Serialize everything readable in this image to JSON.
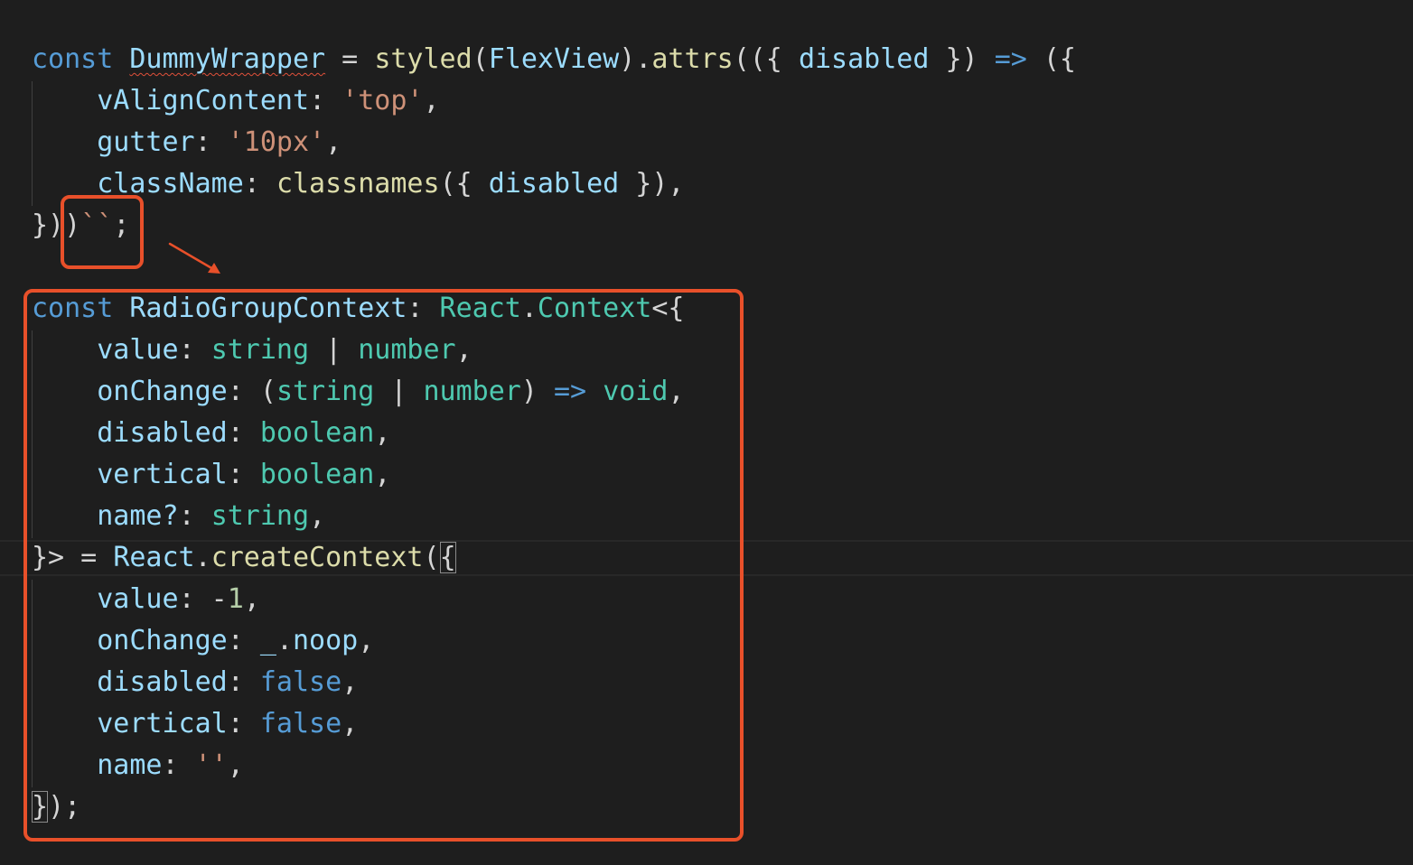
{
  "editor": {
    "lines": [
      [
        {
          "t": "const",
          "c": "kw"
        },
        {
          "t": " ",
          "c": "pun"
        },
        {
          "t": "DummyWrapper",
          "c": "var",
          "squiggle": true
        },
        {
          "t": " = ",
          "c": "pun"
        },
        {
          "t": "styled",
          "c": "fn"
        },
        {
          "t": "(",
          "c": "pun"
        },
        {
          "t": "FlexView",
          "c": "var"
        },
        {
          "t": ").",
          "c": "pun"
        },
        {
          "t": "attrs",
          "c": "fn"
        },
        {
          "t": "(({ ",
          "c": "pun"
        },
        {
          "t": "disabled",
          "c": "var"
        },
        {
          "t": " }) ",
          "c": "pun"
        },
        {
          "t": "=>",
          "c": "kw"
        },
        {
          "t": " ({",
          "c": "pun"
        }
      ],
      [
        {
          "t": "    ",
          "c": "pun"
        },
        {
          "t": "vAlignContent",
          "c": "var"
        },
        {
          "t": ": ",
          "c": "pun"
        },
        {
          "t": "'top'",
          "c": "str"
        },
        {
          "t": ",",
          "c": "pun"
        }
      ],
      [
        {
          "t": "    ",
          "c": "pun"
        },
        {
          "t": "gutter",
          "c": "var"
        },
        {
          "t": ": ",
          "c": "pun"
        },
        {
          "t": "'10px'",
          "c": "str"
        },
        {
          "t": ",",
          "c": "pun"
        }
      ],
      [
        {
          "t": "    ",
          "c": "pun"
        },
        {
          "t": "className",
          "c": "var"
        },
        {
          "t": ": ",
          "c": "pun"
        },
        {
          "t": "classnames",
          "c": "fn"
        },
        {
          "t": "({ ",
          "c": "pun"
        },
        {
          "t": "disabled",
          "c": "var"
        },
        {
          "t": " }),",
          "c": "pun"
        }
      ],
      [
        {
          "t": "})",
          "c": "pun"
        },
        {
          "t": ")",
          "c": "pun"
        },
        {
          "t": "``",
          "c": "str"
        },
        {
          "t": ";",
          "c": "pun"
        }
      ],
      [],
      [
        {
          "t": "const",
          "c": "kw"
        },
        {
          "t": " ",
          "c": "pun"
        },
        {
          "t": "RadioGroupContext",
          "c": "var"
        },
        {
          "t": ": ",
          "c": "pun"
        },
        {
          "t": "React",
          "c": "type"
        },
        {
          "t": ".",
          "c": "pun"
        },
        {
          "t": "Context",
          "c": "type"
        },
        {
          "t": "<{",
          "c": "pun"
        }
      ],
      [
        {
          "t": "    ",
          "c": "pun"
        },
        {
          "t": "value",
          "c": "var"
        },
        {
          "t": ": ",
          "c": "pun"
        },
        {
          "t": "string",
          "c": "type"
        },
        {
          "t": " | ",
          "c": "pun"
        },
        {
          "t": "number",
          "c": "type"
        },
        {
          "t": ",",
          "c": "pun"
        }
      ],
      [
        {
          "t": "    ",
          "c": "pun"
        },
        {
          "t": "onChange",
          "c": "var"
        },
        {
          "t": ": (",
          "c": "pun"
        },
        {
          "t": "string",
          "c": "type"
        },
        {
          "t": " | ",
          "c": "pun"
        },
        {
          "t": "number",
          "c": "type"
        },
        {
          "t": ") ",
          "c": "pun"
        },
        {
          "t": "=>",
          "c": "kw"
        },
        {
          "t": " ",
          "c": "pun"
        },
        {
          "t": "void",
          "c": "type"
        },
        {
          "t": ",",
          "c": "pun"
        }
      ],
      [
        {
          "t": "    ",
          "c": "pun"
        },
        {
          "t": "disabled",
          "c": "var"
        },
        {
          "t": ": ",
          "c": "pun"
        },
        {
          "t": "boolean",
          "c": "type"
        },
        {
          "t": ",",
          "c": "pun"
        }
      ],
      [
        {
          "t": "    ",
          "c": "pun"
        },
        {
          "t": "vertical",
          "c": "var"
        },
        {
          "t": ": ",
          "c": "pun"
        },
        {
          "t": "boolean",
          "c": "type"
        },
        {
          "t": ",",
          "c": "pun"
        }
      ],
      [
        {
          "t": "    ",
          "c": "pun"
        },
        {
          "t": "name?",
          "c": "var"
        },
        {
          "t": ": ",
          "c": "pun"
        },
        {
          "t": "string",
          "c": "type"
        },
        {
          "t": ",",
          "c": "pun"
        }
      ],
      [
        {
          "t": "}> = ",
          "c": "pun"
        },
        {
          "t": "React",
          "c": "var"
        },
        {
          "t": ".",
          "c": "pun"
        },
        {
          "t": "createContext",
          "c": "fn"
        },
        {
          "t": "(",
          "c": "pun"
        },
        {
          "t": "{",
          "c": "pun",
          "match": true
        }
      ],
      [
        {
          "t": "    ",
          "c": "pun"
        },
        {
          "t": "value",
          "c": "var"
        },
        {
          "t": ": -",
          "c": "pun"
        },
        {
          "t": "1",
          "c": "num"
        },
        {
          "t": ",",
          "c": "pun"
        }
      ],
      [
        {
          "t": "    ",
          "c": "pun"
        },
        {
          "t": "onChange",
          "c": "var"
        },
        {
          "t": ": ",
          "c": "pun"
        },
        {
          "t": "_",
          "c": "var"
        },
        {
          "t": ".",
          "c": "pun"
        },
        {
          "t": "noop",
          "c": "var"
        },
        {
          "t": ",",
          "c": "pun"
        }
      ],
      [
        {
          "t": "    ",
          "c": "pun"
        },
        {
          "t": "disabled",
          "c": "var"
        },
        {
          "t": ": ",
          "c": "pun"
        },
        {
          "t": "false",
          "c": "kw"
        },
        {
          "t": ",",
          "c": "pun"
        }
      ],
      [
        {
          "t": "    ",
          "c": "pun"
        },
        {
          "t": "vertical",
          "c": "var"
        },
        {
          "t": ": ",
          "c": "pun"
        },
        {
          "t": "false",
          "c": "kw"
        },
        {
          "t": ",",
          "c": "pun"
        }
      ],
      [
        {
          "t": "    ",
          "c": "pun"
        },
        {
          "t": "name",
          "c": "var"
        },
        {
          "t": ": ",
          "c": "pun"
        },
        {
          "t": "''",
          "c": "str"
        },
        {
          "t": ",",
          "c": "pun"
        }
      ],
      [
        {
          "t": "}",
          "c": "pun",
          "match": true
        },
        {
          "t": ");",
          "c": "pun"
        }
      ]
    ]
  },
  "colors": {
    "background": "#1e1e1e",
    "annotation": "#e8502a"
  }
}
